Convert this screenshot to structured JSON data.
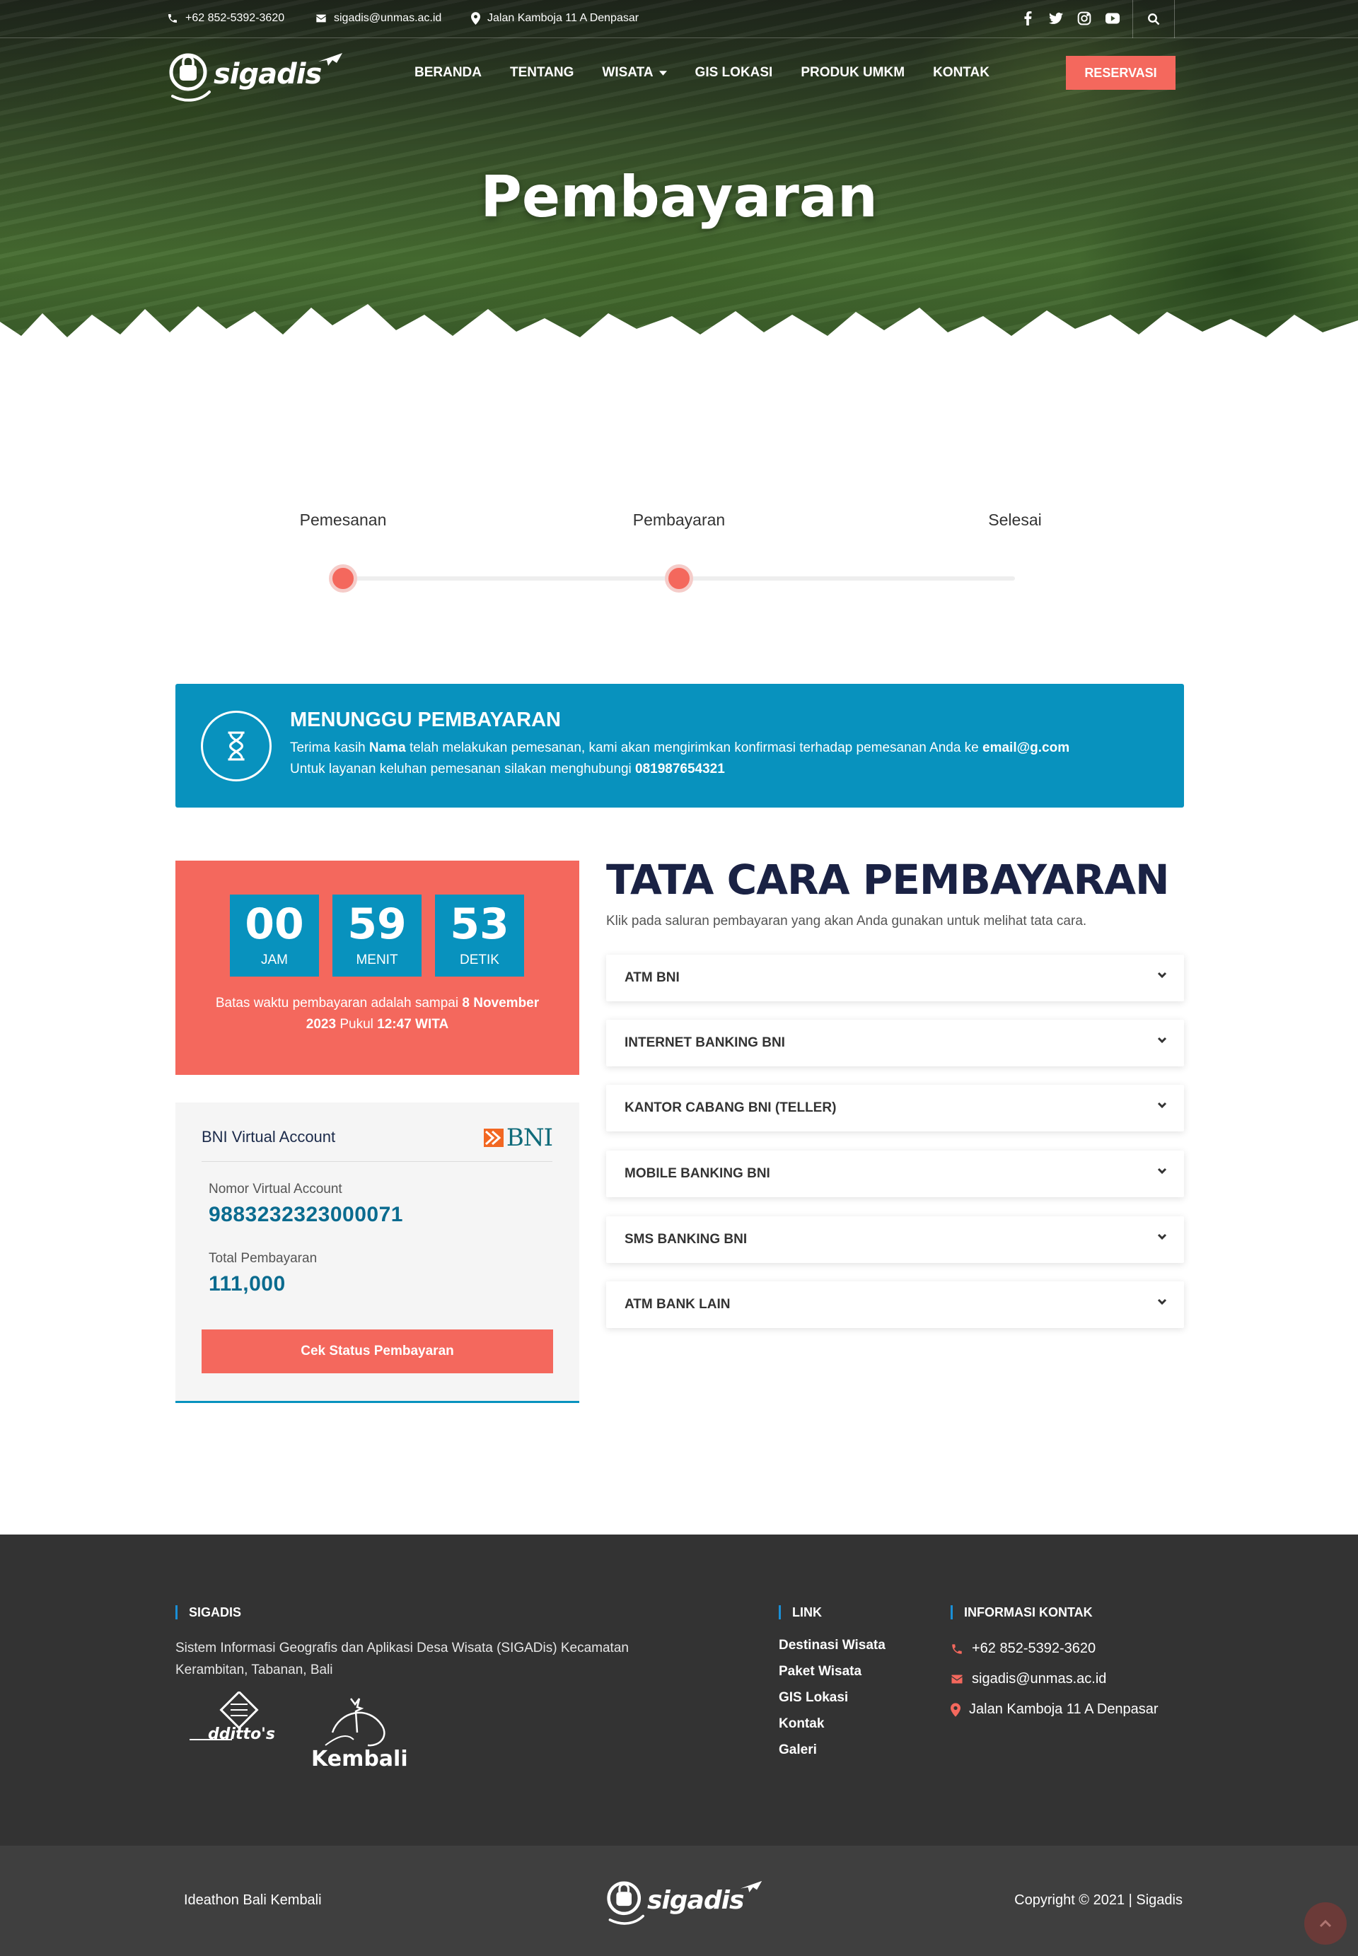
{
  "topbar": {
    "phone": "+62 852-5392-3620",
    "email": "sigadis@unmas.ac.id",
    "address": "Jalan Kamboja 11 A Denpasar"
  },
  "brand": {
    "name": "sigadis"
  },
  "nav": {
    "items": [
      "BERANDA",
      "TENTANG",
      "WISATA",
      "GIS LOKASI",
      "PRODUK UMKM",
      "KONTAK"
    ],
    "reserve_label": "RESERVASI"
  },
  "hero": {
    "title": "Pembayaran"
  },
  "stepper": {
    "steps": [
      "Pemesanan",
      "Pembayaran",
      "Selesai"
    ],
    "current_step": 2
  },
  "status": {
    "title": "MENUNGGU PEMBAYARAN",
    "line1_a": "Terima kasih ",
    "line1_name": "Nama",
    "line1_b": " telah melakukan pemesanan, kami akan mengirimkan konfirmasi terhadap pemesanan Anda ke ",
    "line1_email": "email@g.com",
    "line2_a": "Untuk layanan keluhan pemesanan silakan menghubungi ",
    "line2_phone": "081987654321"
  },
  "countdown": {
    "hours": "00",
    "hours_label": "JAM",
    "minutes": "59",
    "minutes_label": "MENIT",
    "seconds": "53",
    "seconds_label": "DETIK",
    "note_a": "Batas waktu pembayaran adalah sampai ",
    "note_date": "8 November 2023",
    "note_b": " Pukul ",
    "note_time": "12:47 WITA"
  },
  "va": {
    "title": "BNI Virtual Account",
    "bank_logo": "BNI",
    "number_label": "Nomor Virtual Account",
    "number": "9883232323000071",
    "total_label": "Total Pembayaran",
    "total": "111,000",
    "button": "Cek Status Pembayaran"
  },
  "instructions": {
    "title": "TATA CARA PEMBAYARAN",
    "subtitle": "Klik pada saluran pembayaran yang akan Anda gunakan untuk melihat tata cara.",
    "items": [
      "ATM BNI",
      "INTERNET BANKING BNI",
      "KANTOR CABANG BNI (TELLER)",
      "MOBILE BANKING BNI",
      "SMS BANKING BNI",
      "ATM BANK LAIN"
    ]
  },
  "footer": {
    "about_title": "SIGADIS",
    "about_text": "Sistem Informasi Geografis dan Aplikasi Desa Wisata (SIGADis) Kecamatan Kerambitan, Tabanan, Bali",
    "partner1": "dditto's",
    "partner2": "Kembali",
    "links_title": "LINK",
    "links": [
      "Destinasi Wisata",
      "Paket Wisata",
      "GIS Lokasi",
      "Kontak",
      "Galeri"
    ],
    "contact_title": "INFORMASI KONTAK",
    "contact_phone": "+62 852-5392-3620",
    "contact_email": "sigadis@unmas.ac.id",
    "contact_address": "Jalan Kamboja 11 A Denpasar"
  },
  "bottom": {
    "left": "Ideathon Bali Kembali",
    "right": "Copyright © 2021 | Sigadis"
  },
  "colors": {
    "accent": "#f4685d",
    "primary": "#0892be",
    "navy": "#1a2244",
    "footer": "#333333"
  }
}
